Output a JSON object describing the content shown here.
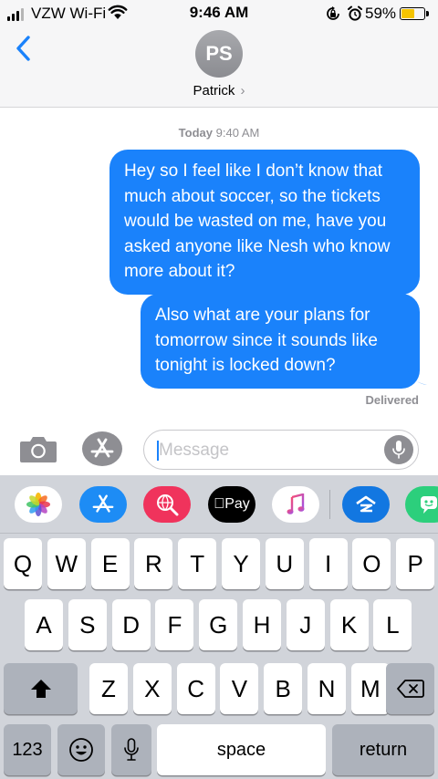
{
  "status_bar": {
    "carrier": "VZW Wi-Fi",
    "time": "9:46 AM",
    "battery_pct": "59%",
    "battery_level": 0.59,
    "icons": [
      "signal-icon",
      "wifi-icon",
      "orientation-lock-icon",
      "alarm-icon",
      "battery-icon"
    ]
  },
  "header": {
    "back_icon": "chevron-left-icon",
    "avatar_initials": "PS",
    "contact_name": "Patrick",
    "contact_chevron": "›"
  },
  "conversation": {
    "timestamp_day": "Today",
    "timestamp_time": "9:40 AM",
    "messages": [
      {
        "from": "me",
        "text": "Hey so I feel like I don’t know that much about soccer, so the tickets would be wasted on me, have you asked anyone like Nesh who know more about it?"
      },
      {
        "from": "me",
        "text": "Also what are your plans for tomorrow since it sounds like tonight is locked down?"
      }
    ],
    "status": "Delivered"
  },
  "compose": {
    "placeholder": "Message",
    "value": "",
    "icons": [
      "camera-icon",
      "app-store-icon",
      "microphone-icon"
    ]
  },
  "app_strip": {
    "apps": [
      {
        "name": "photos-app-icon",
        "bg": "#ffffff"
      },
      {
        "name": "app-store-app-icon",
        "bg": "#1d8cf5"
      },
      {
        "name": "web-images-app-icon",
        "bg": "#f0335c"
      },
      {
        "name": "apple-pay-app-icon",
        "bg": "#000000",
        "label": "Pay"
      },
      {
        "name": "music-app-icon",
        "bg": "#ffffff"
      },
      {
        "name": "zillow-app-icon",
        "bg": "#1277e1"
      },
      {
        "name": "bitmoji-app-icon",
        "bg": "#2ccf7c"
      }
    ]
  },
  "keyboard": {
    "row1": [
      "Q",
      "W",
      "E",
      "R",
      "T",
      "Y",
      "U",
      "I",
      "O",
      "P"
    ],
    "row2": [
      "A",
      "S",
      "D",
      "F",
      "G",
      "H",
      "J",
      "K",
      "L"
    ],
    "row3": [
      "Z",
      "X",
      "C",
      "V",
      "B",
      "N",
      "M"
    ],
    "numbers_key": "123",
    "space_key": "space",
    "return_key": "return",
    "icons": [
      "shift-icon",
      "delete-icon",
      "emoji-icon",
      "dictation-icon"
    ]
  },
  "colors": {
    "bubble_blue": "#1a82fb",
    "secondary_text": "#8e8e93",
    "keyboard_bg": "#d1d4da"
  }
}
